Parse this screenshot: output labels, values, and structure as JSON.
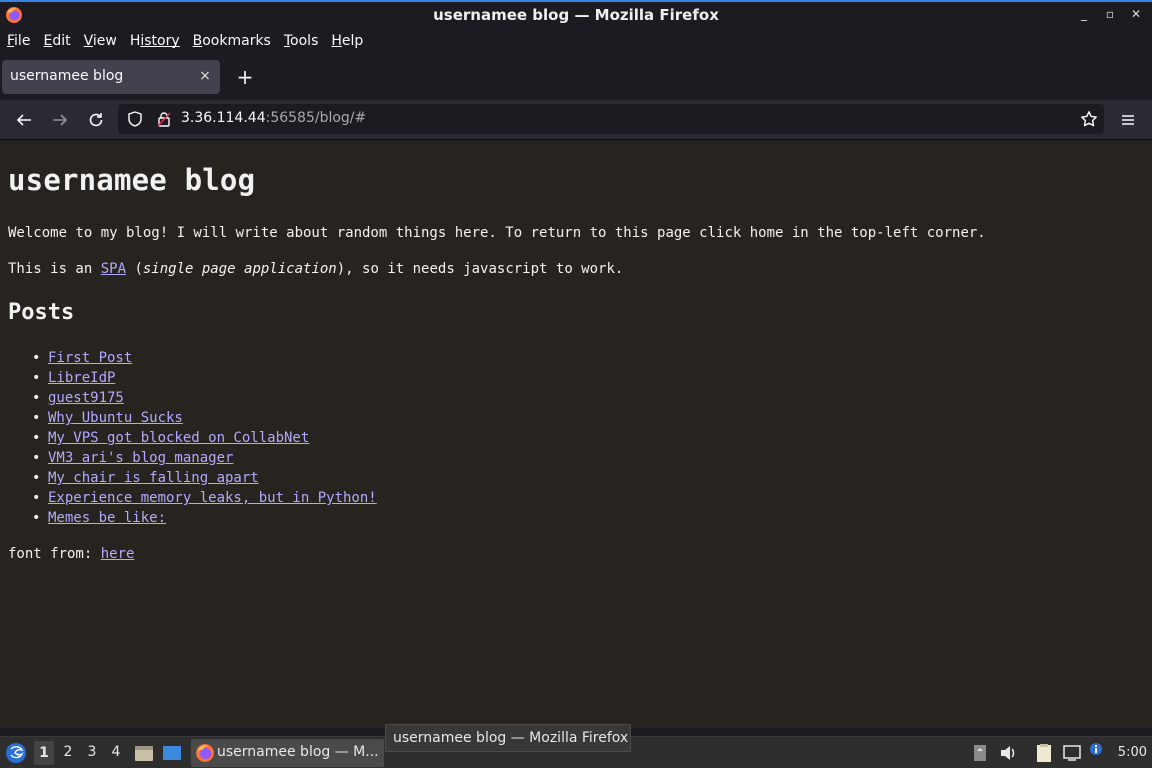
{
  "window": {
    "title": "usernamee blog — Mozilla Firefox"
  },
  "menubar": {
    "items": [
      {
        "accel": "F",
        "rest": "ile"
      },
      {
        "accel": "E",
        "rest": "dit"
      },
      {
        "accel": "V",
        "rest": "iew"
      },
      {
        "accel": "H",
        "rest": "istory"
      },
      {
        "accel": "B",
        "rest": "ookmarks"
      },
      {
        "accel": "T",
        "rest": "ools"
      },
      {
        "accel": "H",
        "rest": "elp"
      }
    ]
  },
  "tabs": {
    "active_title": "usernamee blog",
    "close_glyph": "×",
    "new_tab_glyph": "+"
  },
  "urlbar": {
    "host": "3.36.114.44",
    "rest": ":56585/blog/#"
  },
  "page": {
    "heading": "usernamee blog",
    "intro": "Welcome to my blog! I will write about random things here. To return to this page click home in the top-left corner.",
    "spa_prefix": "This is an ",
    "spa_link": "SPA",
    "spa_open": " (",
    "spa_italic": "single page application",
    "spa_suffix": "), so it needs javascript to work.",
    "posts_heading": "Posts",
    "posts": [
      "First Post",
      "LibreIdP",
      "guest9175",
      "Why Ubuntu Sucks",
      "My VPS got blocked on CollabNet",
      "VM3 ari's blog manager",
      "My chair is falling apart",
      "Experience memory leaks, but in Python!",
      "Memes be like:"
    ],
    "font_prefix": "font from: ",
    "font_link": "here"
  },
  "tooltip": {
    "text": "usernamee blog — Mozilla Firefox"
  },
  "taskbar": {
    "workspaces": [
      "1",
      "2",
      "3",
      "4"
    ],
    "active_workspace": "1",
    "task_title": "usernamee blog — M...",
    "clock": "5:00"
  },
  "colors": {
    "page_bg": "#27231f",
    "link": "#b3aaff",
    "chrome_bg": "#1c1b22",
    "navbar_bg": "#2b2a33",
    "accent": "#3584e4"
  },
  "icons": {
    "app": "firefox-icon",
    "back": "arrow-left-icon",
    "forward": "arrow-right-icon",
    "reload": "reload-icon",
    "tracking": "shield-icon",
    "security": "lock-icon",
    "bookmark": "star-icon",
    "menu": "hamburger-icon"
  }
}
